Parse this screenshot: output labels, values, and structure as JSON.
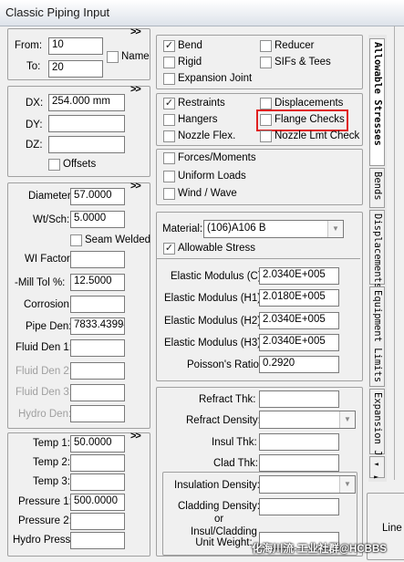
{
  "window": {
    "title": "Classic Piping Input"
  },
  "ui": {
    "collapse_glyph": ">>"
  },
  "from_to": {
    "from_label": "From:",
    "from_value": "10",
    "to_label": "To:",
    "to_value": "20",
    "name_label": "Name"
  },
  "deltas": {
    "dx_label": "DX:",
    "dx_value": "254.000 mm",
    "dy_label": "DY:",
    "dy_value": "",
    "dz_label": "DZ:",
    "dz_value": "",
    "offsets_label": "Offsets"
  },
  "pipe": {
    "diameter_label": "Diameter:",
    "diameter_value": "57.0000",
    "wtsch_label": "Wt/Sch:",
    "wtsch_value": "5.0000",
    "seam_welded_label": "Seam Welded",
    "wi_factor_label": "WI Factor:",
    "wi_factor_value": "",
    "mill_tol_label": "-Mill Tol %:",
    "mill_tol_value": "12.5000",
    "corrosion_label": "Corrosion:",
    "corrosion_value": "",
    "pipe_den_label": "Pipe Den:",
    "pipe_den_value": "7833.43994",
    "fluid_den1_label": "Fluid Den 1:",
    "fluid_den1_value": "",
    "fluid_den2_label": "Fluid Den 2:",
    "fluid_den2_value": "",
    "fluid_den3_label": "Fluid Den 3:",
    "fluid_den3_value": "",
    "hydro_den_label": "Hydro Den:",
    "hydro_den_value": ""
  },
  "temps": {
    "temp1_label": "Temp 1:",
    "temp1_value": "50.0000",
    "temp2_label": "Temp 2:",
    "temp2_value": "",
    "temp3_label": "Temp 3:",
    "temp3_value": "",
    "pressure1_label": "Pressure 1:",
    "pressure1_value": "500.0000",
    "pressure2_label": "Pressure 2:",
    "pressure2_value": "",
    "hydro_press_label": "Hydro Press:",
    "hydro_press_value": ""
  },
  "element_types": {
    "bend": {
      "label": "Bend",
      "checked": true
    },
    "reducer": {
      "label": "Reducer",
      "checked": false
    },
    "rigid": {
      "label": "Rigid",
      "checked": false
    },
    "sifs_tees": {
      "label": "SIFs & Tees",
      "checked": false
    },
    "expansion_joint": {
      "label": "Expansion Joint",
      "checked": false
    }
  },
  "supports": {
    "restraints": {
      "label": "Restraints",
      "checked": true
    },
    "displacements": {
      "label": "Displacements",
      "checked": false
    },
    "hangers": {
      "label": "Hangers",
      "checked": false
    },
    "flange_checks": {
      "label": "Flange Checks",
      "checked": false
    },
    "nozzle_flex": {
      "label": "Nozzle Flex.",
      "checked": false
    },
    "nozzle_lmt_check": {
      "label": "Nozzle Lmt Check",
      "checked": false
    }
  },
  "loads": {
    "forces_moments": {
      "label": "Forces/Moments",
      "checked": false
    },
    "uniform_loads": {
      "label": "Uniform Loads",
      "checked": false
    },
    "wind_wave": {
      "label": "Wind / Wave",
      "checked": false
    }
  },
  "material": {
    "material_label": "Material:",
    "material_value": "(106)A106 B",
    "allowable_stress_label": "Allowable Stress",
    "allowable_stress_checked": true
  },
  "elastic": {
    "ec_label": "Elastic Modulus (C):",
    "ec_value": "2.0340E+005",
    "eh1_label": "Elastic Modulus (H1):",
    "eh1_value": "2.0180E+005",
    "eh2_label": "Elastic Modulus (H2):",
    "eh2_value": "2.0340E+005",
    "eh3_label": "Elastic Modulus (H3):",
    "eh3_value": "2.0340E+005",
    "poisson_label": "Poisson's Ratio:",
    "poisson_value": "0.2920"
  },
  "insulation": {
    "refract_thk_label": "Refract Thk:",
    "refract_thk_value": "",
    "refract_density_label": "Refract Density:",
    "refract_density_value": "",
    "insul_thk_label": "Insul Thk:",
    "insul_thk_value": "",
    "clad_thk_label": "Clad Thk:",
    "clad_thk_value": "",
    "insulation_density_label": "Insulation Density:",
    "insulation_density_value": "",
    "cladding_density_label": "Cladding Density:",
    "cladding_density_value": "",
    "or_label": "or",
    "insul_cladding_weight_label": "Insul/Cladding\nUnit Weight:",
    "insul_cladding_weight_value": ""
  },
  "side_tabs": [
    {
      "label": "Allowable Stresses",
      "active": true
    },
    {
      "label": "Bends",
      "active": false
    },
    {
      "label": "Displacements",
      "active": false
    },
    {
      "label": "Equipment Limits",
      "active": false
    },
    {
      "label": "Expansion J",
      "active": false
    }
  ],
  "side_tab_scroll": "◄ ►",
  "right_panel": {
    "line_label": "Line"
  },
  "watermark": "化海川流-工业社群@HCBBS"
}
